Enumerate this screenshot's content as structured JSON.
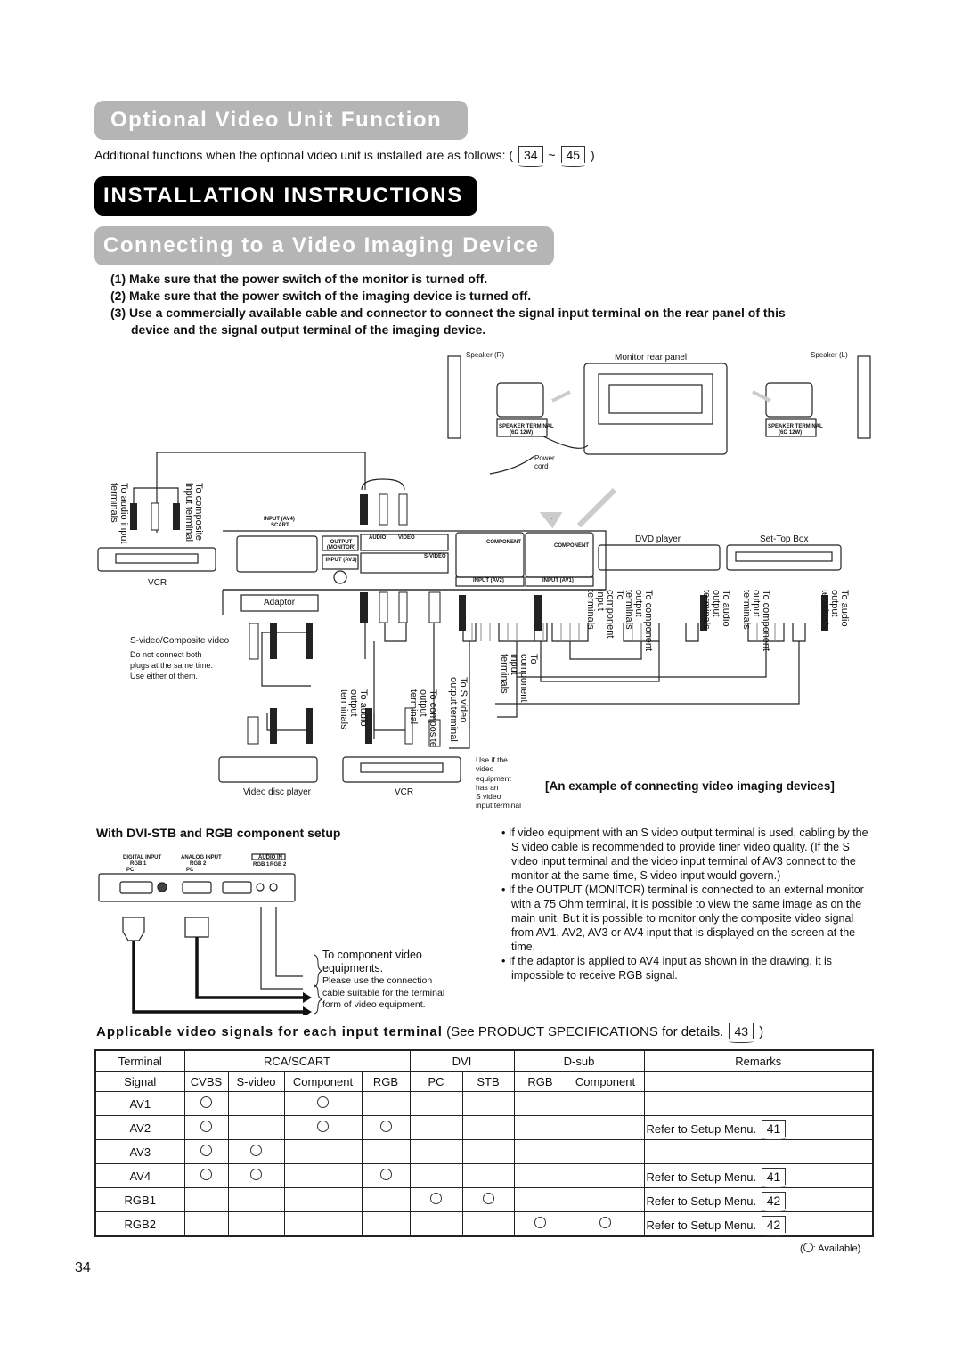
{
  "section_title": "Optional Video Unit Function",
  "intro": {
    "text": "Additional functions when the optional video unit is installed are as follows: (",
    "ref_start": "34",
    "tilde": "~",
    "ref_end": "45",
    "close": ")"
  },
  "installation_title": "INSTALLATION INSTRUCTIONS",
  "connecting_title": "Connecting to a Video Imaging Device",
  "steps": [
    {
      "num": "(1)",
      "text": "Make sure that the power switch of the monitor is turned off."
    },
    {
      "num": "(2)",
      "text": "Make sure that the power switch of the imaging device is turned off."
    },
    {
      "num": "(3)",
      "text": "Use a commercially available cable and connector to connect the signal input terminal on the rear panel of this",
      "text2": "device and the signal output terminal of the imaging device."
    }
  ],
  "diagram": {
    "speaker_r": "Speaker (R)",
    "monitor_rear_panel": "Monitor rear panel",
    "speaker_l": "Speaker (L)",
    "speaker_terminal": "SPEAKER TERMINAL",
    "speaker_spec": "(6Ω 12W)",
    "power_cord": "Power cord",
    "to_audio_input": "To audio input terminals",
    "to_composite_input": "To composite input terminal",
    "vcr": "VCR",
    "input_av4": "INPUT (AV4)",
    "scart": "SCART",
    "output_monitor": "OUTPUT (MONITOR)",
    "input_av3": "INPUT (AV3)",
    "audio": "AUDIO",
    "video": "VIDEO",
    "s_video": "S-VIDEO",
    "component": "COMPONENT",
    "input_av2": "INPUT (AV2)",
    "input_av1": "INPUT (AV1)",
    "dvd_player": "DVD player",
    "set_top_box": "Set-Top Box",
    "adaptor": "Adaptor",
    "s_video_composite": "S-video/Composite video",
    "do_not_connect": [
      "Do not connect both",
      "plugs at the same time.",
      "Use either of them."
    ],
    "to_audio_output": "To audio output terminals",
    "to_composite_output": "To composite output terminal",
    "to_s_video_output": "To S video output terminal",
    "to_component_input": "To component input terminals",
    "to_component_output": "To component output terminals",
    "use_if": [
      "Use if the",
      "video",
      "equipment",
      "has an",
      "S video",
      "input terminal"
    ],
    "video_disc_player": "Video disc player",
    "vcr2": "VCR",
    "caption": "[An example of connecting video imaging devices]"
  },
  "dvi_setup": {
    "title": "With DVI-STB and RGB component setup",
    "digital_input": "DIGITAL INPUT",
    "rgb1": "RGB 1",
    "analog_input": "ANALOG INPUT",
    "rgb2": "RGB 2",
    "pc": "PC",
    "audio_in": "AUDIO IN",
    "note_main": "To component video",
    "note_main2": "equipments.",
    "note_sub": [
      "Please use the connection",
      "cable suitable for the terminal",
      "form of video equipment."
    ]
  },
  "bullets": [
    "If video equipment with an S video output terminal is used, cabling by the S video cable is recommended to provide finer video quality.  (If the S video input terminal and the video input terminal of AV3 connect to the monitor at the same time, S video input would govern.)",
    "If the OUTPUT (MONITOR) terminal is connected to an external monitor with a 75 Ohm terminal, it is possible to view the same image as on the main unit. But it is possible to monitor only the composite video signal from AV1, AV2, AV3 or AV4 input that is displayed on the screen at the time.",
    "If the adaptor is applied to AV4 input as shown in the drawing, it is impossible to  receive RGB signal."
  ],
  "signals": {
    "heading_bold": "Applicable video signals for each input terminal",
    "heading_rest": "(See PRODUCT SPECIFICATIONS for details.",
    "heading_ref": "43",
    "heading_close": ")",
    "groups": [
      "Terminal",
      "RCA/SCART",
      "DVI",
      "D-sub",
      "Remarks"
    ],
    "columns": [
      "Signal",
      "CVBS",
      "S-video",
      "Component",
      "RGB",
      "PC",
      "STB",
      "RGB",
      "Component"
    ],
    "rows": [
      {
        "name": "AV1",
        "avail": [
          1,
          0,
          1,
          0,
          0,
          0,
          0,
          0
        ],
        "remark": "",
        "ref": ""
      },
      {
        "name": "AV2",
        "avail": [
          1,
          0,
          1,
          1,
          0,
          0,
          0,
          0
        ],
        "remark": "Refer to Setup Menu.",
        "ref": "41"
      },
      {
        "name": "AV3",
        "avail": [
          1,
          1,
          0,
          0,
          0,
          0,
          0,
          0
        ],
        "remark": "",
        "ref": ""
      },
      {
        "name": "AV4",
        "avail": [
          1,
          1,
          0,
          1,
          0,
          0,
          0,
          0
        ],
        "remark": "Refer to Setup Menu.",
        "ref": "41"
      },
      {
        "name": "RGB1",
        "avail": [
          0,
          0,
          0,
          0,
          1,
          1,
          0,
          0
        ],
        "remark": "Refer to Setup Menu.",
        "ref": "42"
      },
      {
        "name": "RGB2",
        "avail": [
          0,
          0,
          0,
          0,
          0,
          0,
          1,
          1
        ],
        "remark": "Refer to Setup Menu.",
        "ref": "42"
      }
    ],
    "legend": ": Available"
  },
  "page_number": "34"
}
